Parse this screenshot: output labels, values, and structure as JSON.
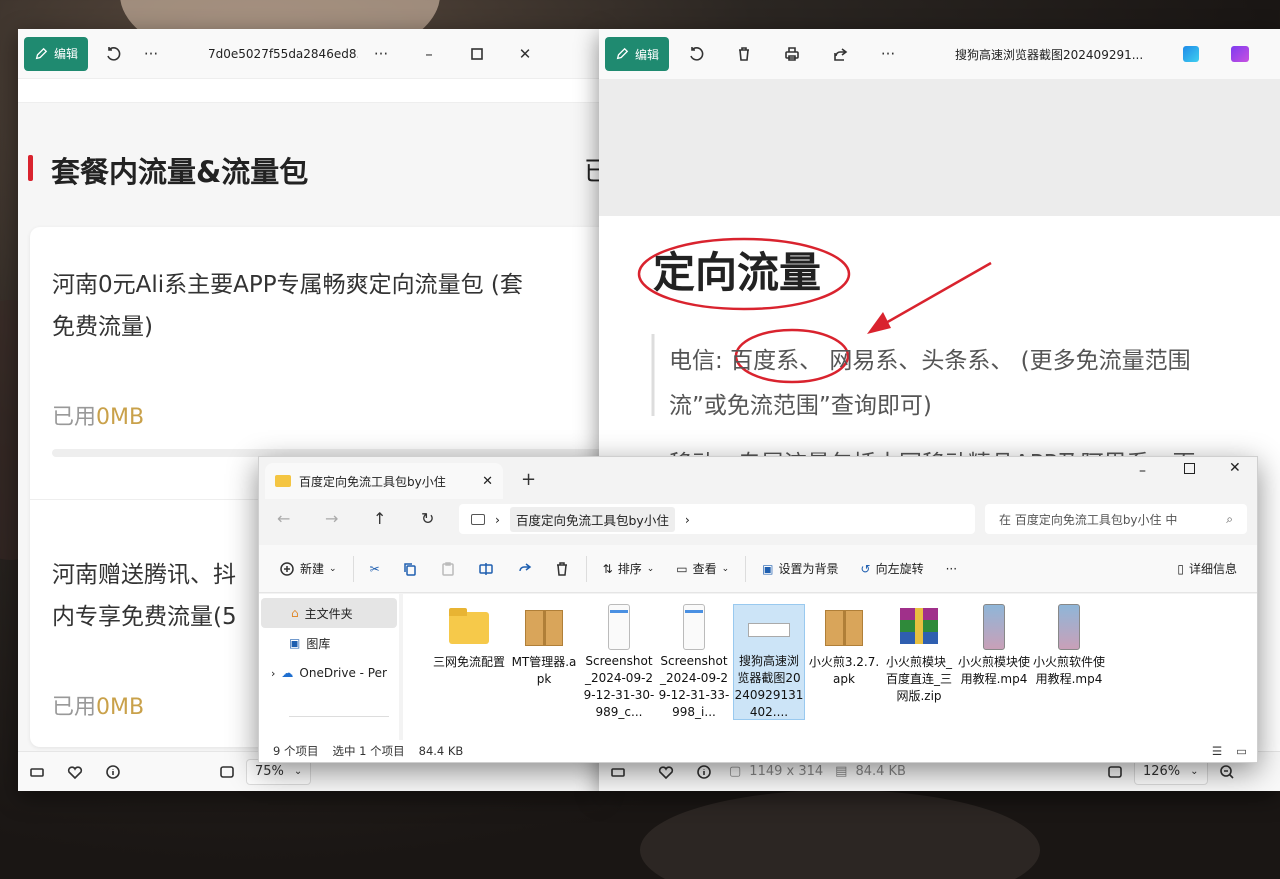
{
  "left_viewer": {
    "edit_label": "编辑",
    "title": "7d0e5027f55da2846ed8...",
    "section_title": "套餐内流量&流量包",
    "clipped_right": "已",
    "card1_text": "河南0元Ali系主要APP专属畅爽定向流量包 (套",
    "card1_text2": "免费流量)",
    "used_label": "已用",
    "used_value": "0MB",
    "card2_text": "河南赠送腾讯、抖",
    "card2_text2": "内专享免费流量(5",
    "used2_label": "已用",
    "used2_value": "0MB",
    "zoom": "75%"
  },
  "right_viewer": {
    "edit_label": "编辑",
    "title": "搜狗高速浏览器截图202409291...",
    "heading": "定向流量",
    "line1_prefix": "电信:",
    "line1_circled": "百度系、",
    "line1_rest": "网易系、头条系、 (更多免流量范围",
    "line2": "流”或免流范围”查询即可)",
    "line3": "移动：专属流量包括中国移动精品APP及阿里系、百",
    "dimensions": "1149 x 314",
    "size": "84.4 KB",
    "zoom": "126%"
  },
  "explorer": {
    "tab_title": "百度定向免流工具包by小住",
    "breadcrumb": "百度定向免流工具包by小住",
    "search_placeholder": "在 百度定向免流工具包by小住 中",
    "toolbar": {
      "new": "新建",
      "sort": "排序",
      "view": "查看",
      "set_bg": "设置为背景",
      "rotate_left": "向左旋转",
      "details": "详细信息"
    },
    "nav": {
      "home": "主文件夹",
      "gallery": "图库",
      "onedrive": "OneDrive - Per"
    },
    "files": [
      {
        "name": "三网免流配置",
        "icon": "folder-icon"
      },
      {
        "name": "MT管理器.apk",
        "icon": "package-icon"
      },
      {
        "name": "Screenshot_2024-09-29-12-31-30-989_c...",
        "icon": "phone-screenshot-icon"
      },
      {
        "name": "Screenshot_2024-09-29-12-31-33-998_i...",
        "icon": "phone-screenshot-icon"
      },
      {
        "name": "搜狗高速浏览器截图20240929131402....",
        "icon": "image-thumbnail-icon",
        "selected": true
      },
      {
        "name": "小火煎3.2.7.apk",
        "icon": "package-icon"
      },
      {
        "name": "小火煎模块_百度直连_三网版.zip",
        "icon": "winrar-icon"
      },
      {
        "name": "小火煎模块使用教程.mp4",
        "icon": "video-icon"
      },
      {
        "name": "小火煎软件使用教程.mp4",
        "icon": "video-icon"
      }
    ],
    "status_count": "9 个项目",
    "status_selected": "选中 1 个项目",
    "status_size": "84.4 KB"
  },
  "colors": {
    "accent_green": "#1f8a70",
    "gold": "#c9a14a",
    "red_mark": "#d9232e"
  }
}
